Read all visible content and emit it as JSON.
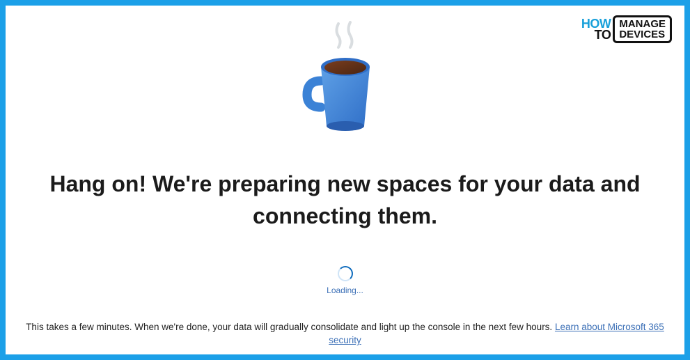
{
  "watermark": {
    "how": "HOW",
    "to": "TO",
    "line1": "MANAGE",
    "line2": "DEVICES"
  },
  "heading": "Hang on! We're preparing new spaces for your data and connecting them.",
  "loading_label": "Loading...",
  "footer": {
    "text": "This takes a few minutes. When we're done, your data will gradually consolidate and light up the console in the next few hours. ",
    "link_text": "Learn about Microsoft 365 security"
  }
}
